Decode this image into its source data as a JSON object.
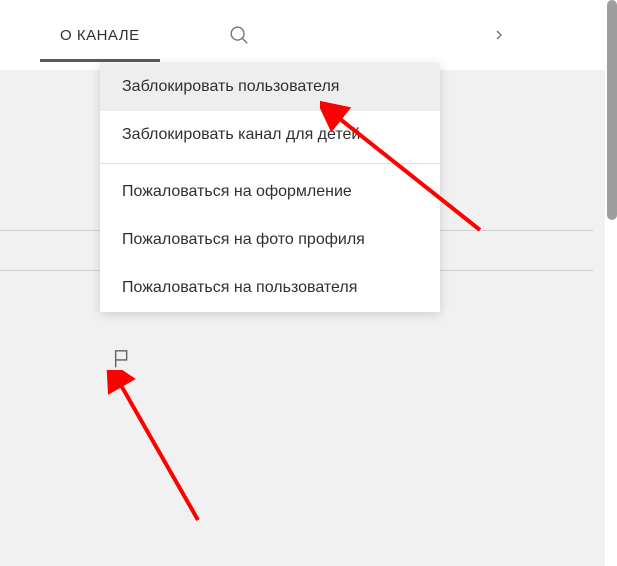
{
  "tabs": {
    "about_label": "О КАНАЛЕ"
  },
  "dropdown": {
    "items": [
      "Заблокировать пользователя",
      "Заблокировать канал для детей",
      "Пожаловаться на оформление",
      "Пожаловаться на фото профиля",
      "Пожаловаться на пользователя"
    ]
  },
  "annotations": {
    "arrow_color": "#ff0000"
  }
}
